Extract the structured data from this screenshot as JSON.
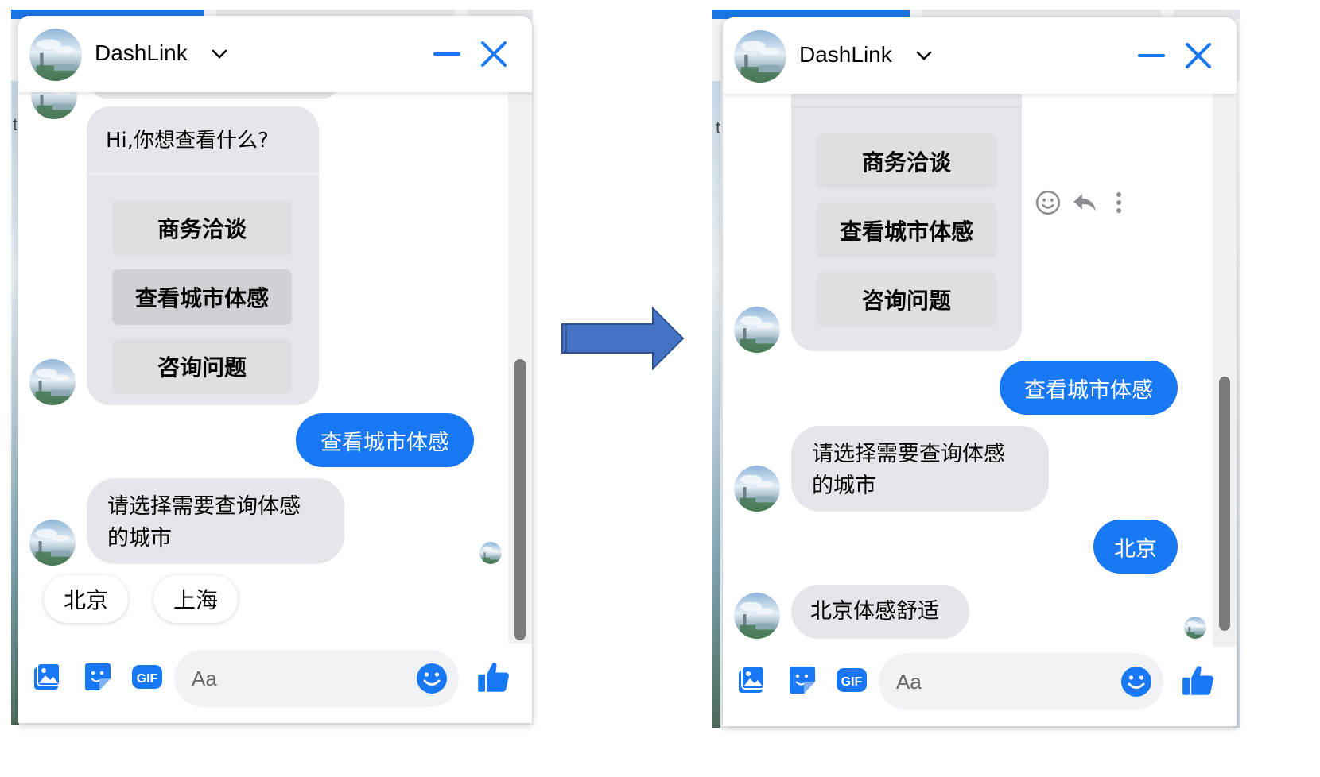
{
  "colors": {
    "messenger_blue": "#1877f2",
    "bubble_gray": "#e4e6eb",
    "arrow_fill": "#4472c4",
    "arrow_stroke": "#2f528f"
  },
  "left": {
    "header": {
      "name": "DashLink"
    },
    "bot_card": {
      "title": "Hi,你想查看什么?",
      "buttons": [
        "商务洽谈",
        "查看城市体感",
        "咨询问题"
      ]
    },
    "user_reply": "查看城市体感",
    "bot_prompt": {
      "line1": "请选择需要查询体感",
      "line2": "的城市"
    },
    "quick_replies": [
      "北京",
      "上海"
    ],
    "input_placeholder": "Aa",
    "bg_letter": "t"
  },
  "right": {
    "header": {
      "name": "DashLink"
    },
    "bot_card": {
      "buttons": [
        "商务洽谈",
        "查看城市体感",
        "咨询问题"
      ]
    },
    "user_reply_1": "查看城市体感",
    "bot_prompt": {
      "line1": "请选择需要查询体感",
      "line2": "的城市"
    },
    "user_reply_2": "北京",
    "bot_answer": "北京体感舒适",
    "input_placeholder": "Aa",
    "bg_letter": "t"
  },
  "icons": {
    "photo": "photo-icon",
    "sticker": "sticker-icon",
    "gif": "gif-icon",
    "emoji": "emoji-icon",
    "like": "thumbs-up-icon",
    "react": "react-emoji-icon",
    "reply": "reply-arrow-icon",
    "more": "more-vertical-icon",
    "gif_label": "GIF"
  }
}
